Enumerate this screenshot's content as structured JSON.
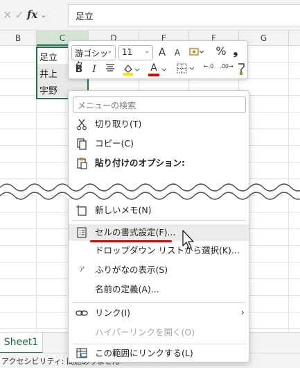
{
  "formula_bar": {
    "cancel_glyph": "✕",
    "enter_glyph": "✓",
    "fx_label": "fx",
    "dropdown_glyph": "⌄",
    "value": "足立"
  },
  "columns": [
    "B",
    "C",
    "D",
    "E",
    "F",
    "G"
  ],
  "selected_column": "C",
  "cells": [
    "足立",
    "井上",
    "宇野"
  ],
  "mini_toolbar": {
    "font_name": "游ゴシック",
    "font_size": "11",
    "grow_font": "A",
    "shrink_font": "A",
    "percent": "%",
    "comma": "❟",
    "bold": "B",
    "italic": "I",
    "font_color_letter": "A",
    "dec_increase": "←.0",
    "dec_decrease": ".00→",
    "dropdown_glyph": "⌄"
  },
  "context_menu": {
    "search_placeholder": "メニューの検索",
    "items": [
      {
        "icon": "scissors-icon",
        "label": "切り取り(T)"
      },
      {
        "icon": "copy-icon",
        "label": "コピー(C)"
      },
      {
        "icon": "paste-icon",
        "label": "貼り付けのオプション:"
      },
      {
        "icon": "new-note-icon",
        "label": "新しいメモ(N)"
      },
      {
        "icon": "format-cells-icon",
        "label": "セルの書式設定(F)..."
      },
      {
        "icon": "",
        "label": "ドロップダウン リストから選択(K)..."
      },
      {
        "icon": "phonetic-icon",
        "label": "ふりがなの表示(S)"
      },
      {
        "icon": "",
        "label": "名前の定義(A)..."
      },
      {
        "icon": "link-icon",
        "label": "リンク(I)"
      },
      {
        "icon": "",
        "label": "ハイパーリンクを開く(O)"
      },
      {
        "icon": "link-range-icon",
        "label": "この範囲にリンクする(L)"
      }
    ],
    "submenu_arrow": "›",
    "phonetic_glyph": "ア"
  },
  "sheet_tab": "Sheet1",
  "status_text": "アクセシビリティ: 問題ありません"
}
